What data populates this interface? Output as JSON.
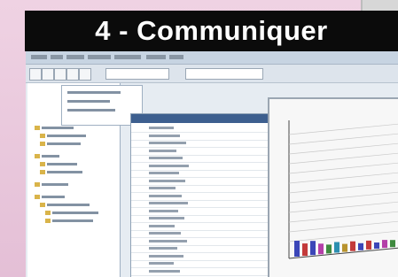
{
  "title": "4 - Communiquer",
  "colors": {
    "background": "#e9c8dc",
    "title_bar": "#0b0b0b",
    "title_text": "#ffffff",
    "app_background": "#e6ecf2",
    "chart_bar_colors": [
      "#3b46b8",
      "#c33a3a",
      "#3b46b8",
      "#b43fa8",
      "#3f8a3f",
      "#2c8fb0",
      "#b8932e",
      "#c33a3a"
    ]
  }
}
